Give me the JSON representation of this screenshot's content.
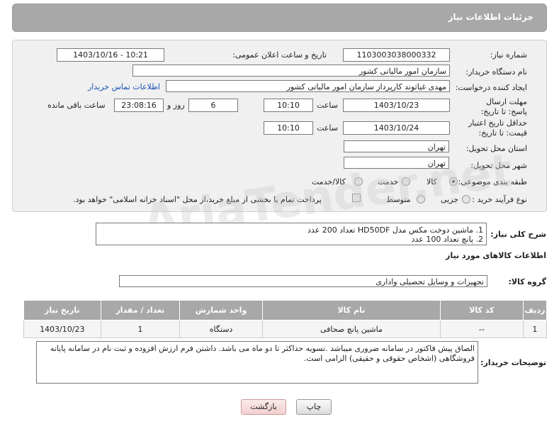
{
  "header": {
    "title": "جزئیات اطلاعات نیاز"
  },
  "form": {
    "need_number_label": "شماره نیاز:",
    "need_number": "1103003038000332",
    "announce_label": "تاریخ و ساعت اعلان عمومی:",
    "announce_value": "1403/10/16 - 10:21",
    "buyer_org_label": "نام دستگاه خریدار:",
    "buyer_org": "سازمان امور مالیاتی کشور",
    "creator_label": "ایجاد کننده درخواست:",
    "creator": "مهدی غیاثوند کارپرداز سازمان امور مالیاتی کشور",
    "contact_link": "اطلاعات تماس خریدار",
    "deadline_label": "مهلت ارسال پاسخ: تا تاریخ:",
    "deadline_date": "1403/10/23",
    "time_label": "ساعت",
    "deadline_time": "10:10",
    "days_value": "6",
    "days_label": "روز و",
    "remaining_time": "23:08:16",
    "remaining_label": "ساعت باقی مانده",
    "validity_label": "حداقل تاریخ اعتبار قیمت: تا تاریخ:",
    "validity_date": "1403/10/24",
    "validity_time": "10:10",
    "province_label": "استان محل تحویل:",
    "province": "تهران",
    "city_label": "شهر محل تحویل:",
    "city": "تهران",
    "category_label": "طبقه بندی موضوعی:",
    "category_options": [
      "کالا",
      "خدمت",
      "کالا/خدمت"
    ],
    "process_label": "نوع فرآیند خرید :",
    "process_options": [
      "جزیی",
      "متوسط"
    ],
    "payment_note": "پرداخت تمام یا بخشی از مبلغ خرید،از محل \"اسناد خزانه اسلامی\" خواهد بود."
  },
  "description": {
    "label": "شرح کلی نیاز:",
    "line1": "1. ماشین دوخت مکس مدل HD50DF تعداد 200 عدد",
    "line2": "2. پانچ تعداد 100 عدد"
  },
  "goods": {
    "section_title": "اطلاعات کالاهای مورد نیاز",
    "group_label": "گروه کالا:",
    "group_value": "تجهیزات و وسایل تحصیلی واداری",
    "columns": [
      "ردیف",
      "کد کالا",
      "نام کالا",
      "واحد شمارش",
      "تعداد / مقدار",
      "تاریخ نیاز"
    ],
    "rows": [
      [
        "1",
        "--",
        "ماشین پانچ صحافی",
        "دستگاه",
        "1",
        "1403/10/23"
      ]
    ]
  },
  "notes": {
    "label": "توضیحات خریدار:",
    "text": "الصاق پیش فاکتور در سامانه ضروری میباشد .تسویه حداکثر تا دو ماه می باشد.  داشتن فرم ارزش افزوده و ثبت نام در سامانه پایانه فروشگاهی (اشخاص حقوقی و حقیقی) الزامی است."
  },
  "buttons": {
    "print": "چاپ",
    "back": "بازگشت"
  }
}
